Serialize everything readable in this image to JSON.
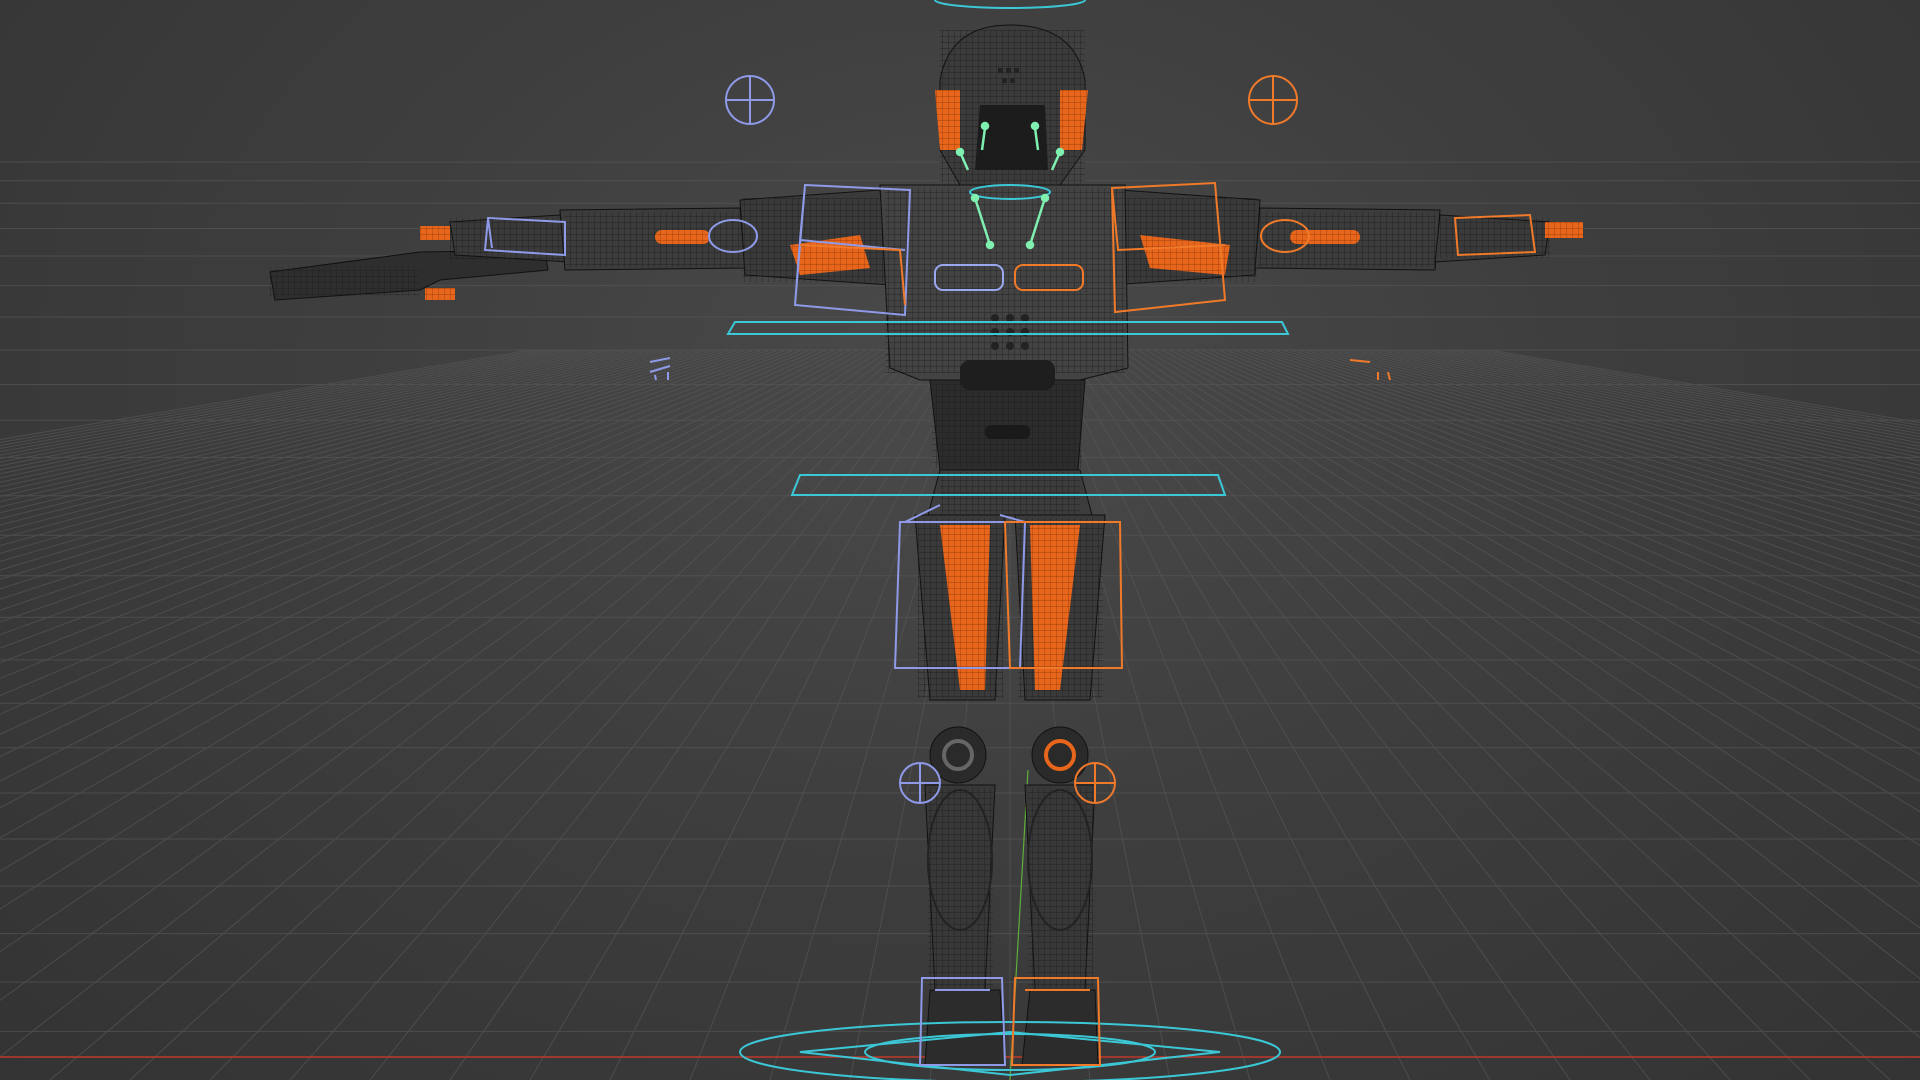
{
  "viewport": {
    "kind": "3d-viewport-rig-preview",
    "subject": "robot-character-t-pose",
    "shading": "wireframe-overlay",
    "colors": {
      "background": "#3e3e3e",
      "grid": "#5a5a5a",
      "x_axis": "#c0392b",
      "y_axis": "#5fae3a",
      "body_dark": "#2b2b2b",
      "body_mid": "#4a4a4a",
      "accent_orange": "#e8661c",
      "control_cyan": "#3cc7d6",
      "control_left_blue": "#8e9ae8",
      "control_right_orange": "#f07a2a",
      "face_bones_green": "#7ff0b0"
    },
    "icons": [
      "root-control-circle",
      "hip-control-ring",
      "chest-control-ring",
      "ik-target-crosshair",
      "bone-box-control"
    ]
  }
}
